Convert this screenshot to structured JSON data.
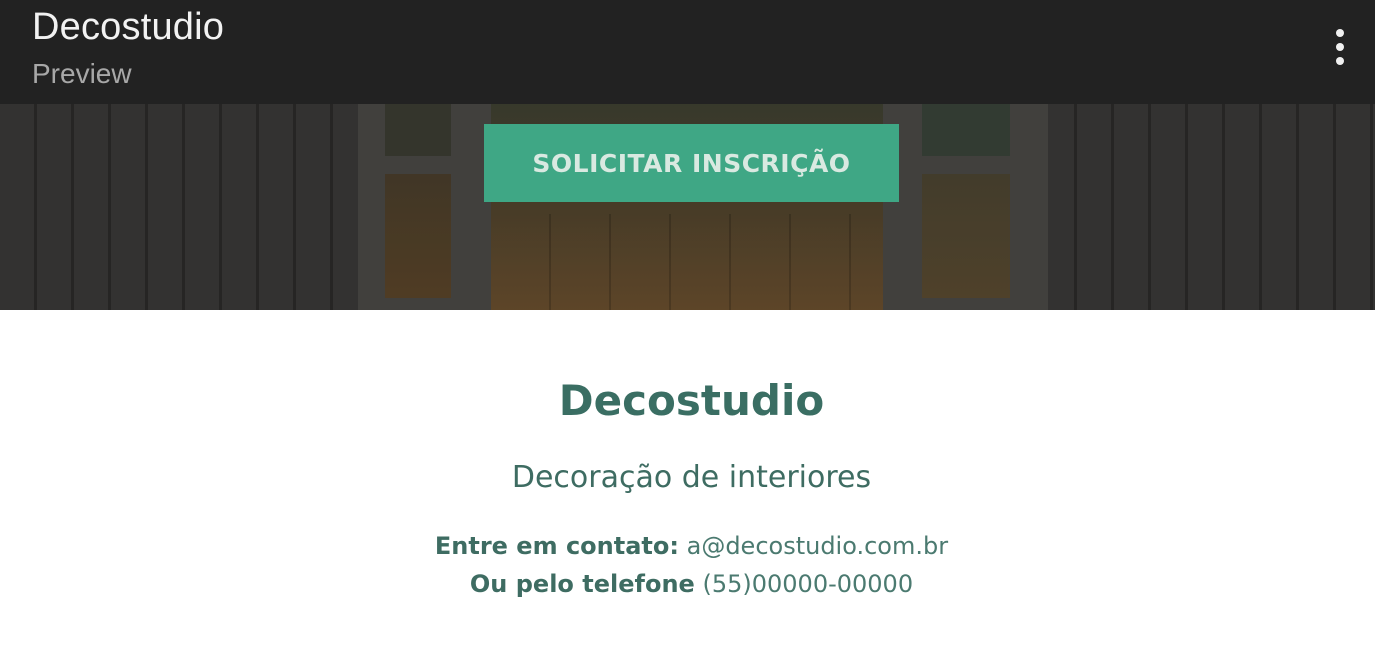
{
  "appbar": {
    "title": "Decostudio",
    "subtitle": "Preview",
    "menu_icon": "more-vert-icon"
  },
  "hero": {
    "cta_label": "SOLICITAR INSCRIÇÃO",
    "cta_color": "#3fa785"
  },
  "content": {
    "brand_name": "Decostudio",
    "tagline": "Decoração de interiores",
    "contact_email_label": "Entre em contato:",
    "contact_email": "a@decostudio.com.br",
    "contact_phone_label": "Ou pelo telefone",
    "contact_phone": "(55)00000-00000",
    "accent_color": "#3a6e63"
  }
}
